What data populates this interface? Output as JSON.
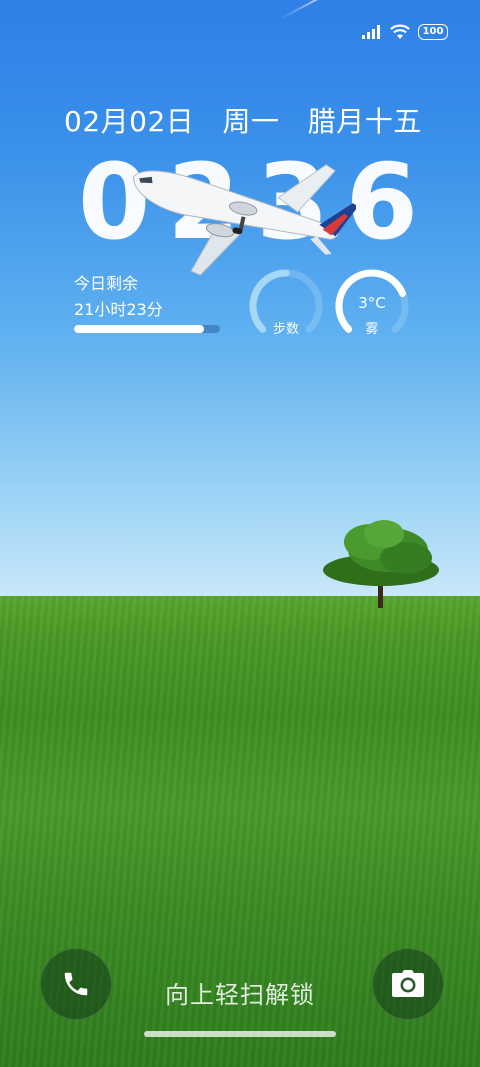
{
  "status_bar": {
    "battery_level": "100",
    "icons": [
      "signal-icon",
      "wifi-icon",
      "battery-icon"
    ]
  },
  "lockscreen": {
    "date": "02月02日",
    "weekday": "周一",
    "lunar_date": "腊月十五",
    "clock": {
      "h1": "0",
      "h2": "2",
      "m1": "3",
      "m2": "6"
    },
    "day_remaining": {
      "title": "今日剩余",
      "value": "21小时23分",
      "progress_fraction": 0.89
    },
    "steps_widget": {
      "label": "步数",
      "progress_fraction": 0.5
    },
    "weather_widget": {
      "temperature": "3°C",
      "condition": "雾",
      "progress_fraction": 0.75
    },
    "unlock_hint": "向上轻扫解锁",
    "shortcuts": {
      "left": "phone-icon",
      "right": "camera-icon"
    }
  },
  "colors": {
    "sky_top": "#2f7fe6",
    "sky_bottom": "#cfeafb",
    "field": "#4c9a26",
    "widget_ring": "#a6d8f6"
  }
}
